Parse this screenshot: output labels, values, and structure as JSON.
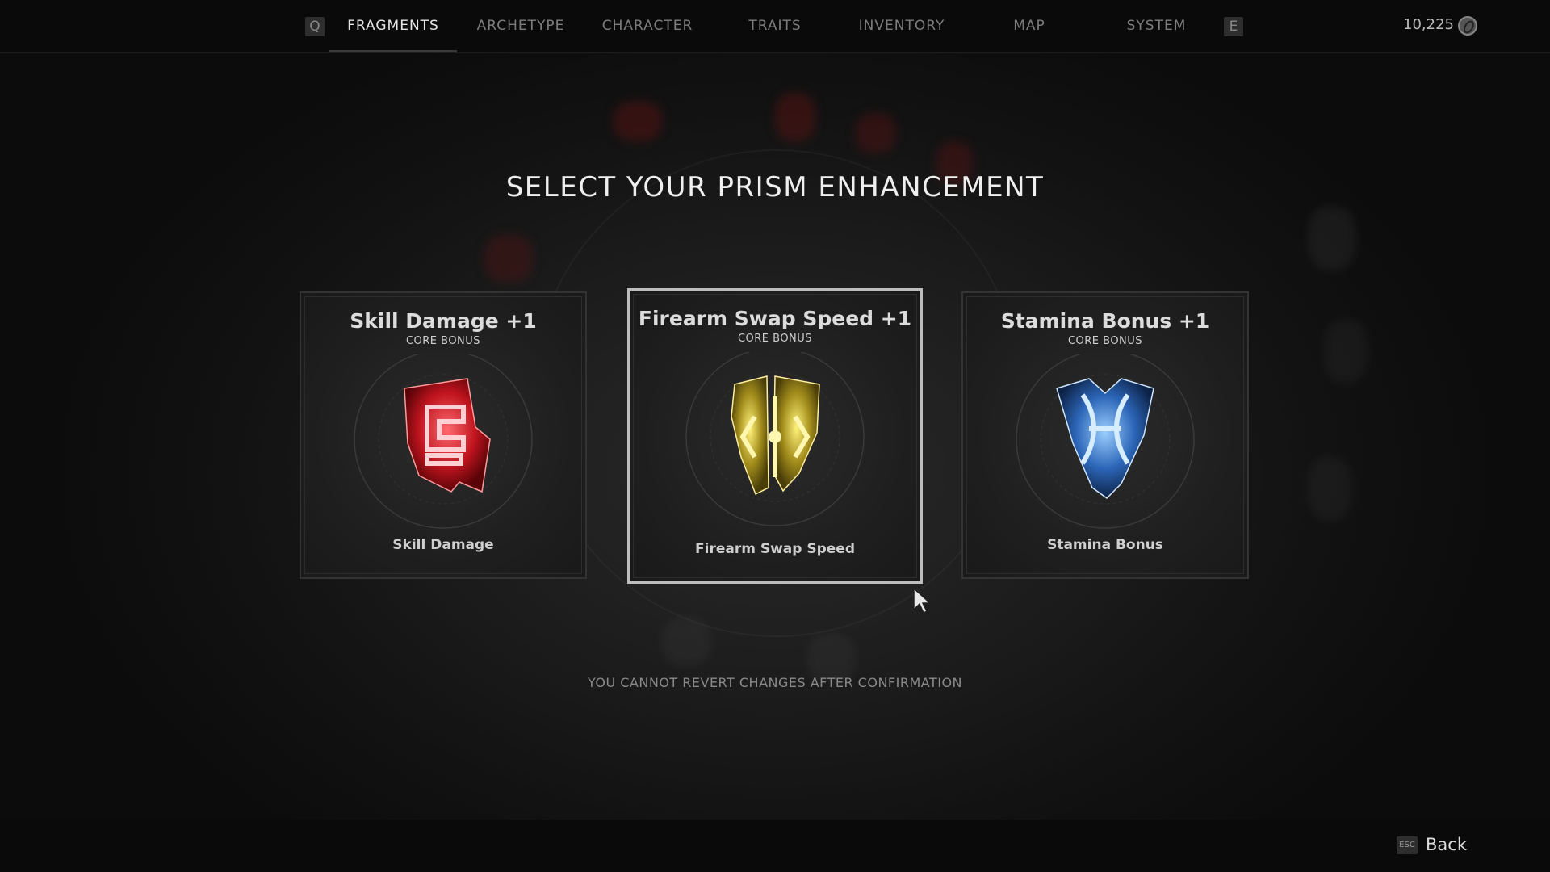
{
  "nav": {
    "left_key": "Q",
    "right_key": "E",
    "tabs": [
      {
        "label": "FRAGMENTS",
        "active": true
      },
      {
        "label": "ARCHETYPE",
        "active": false
      },
      {
        "label": "CHARACTER",
        "active": false
      },
      {
        "label": "TRAITS",
        "active": false
      },
      {
        "label": "INVENTORY",
        "active": false
      },
      {
        "label": "MAP",
        "active": false
      },
      {
        "label": "SYSTEM",
        "active": false
      }
    ],
    "currency": "10,225",
    "currency_icon": "scrap-coin-icon"
  },
  "title": "SELECT YOUR PRISM ENHANCEMENT",
  "cards": [
    {
      "title": "Skill Damage +1",
      "subtitle": "CORE BONUS",
      "name": "Skill Damage",
      "icon": "red-fragment-icon",
      "color": "#e0222c",
      "selected": false
    },
    {
      "title": "Firearm Swap Speed +1",
      "subtitle": "CORE BONUS",
      "name": "Firearm Swap Speed",
      "icon": "gold-fragment-icon",
      "color": "#c9b12a",
      "selected": true
    },
    {
      "title": "Stamina Bonus +1",
      "subtitle": "CORE BONUS",
      "name": "Stamina Bonus",
      "icon": "blue-fragment-icon",
      "color": "#3b7fd9",
      "selected": false
    }
  ],
  "warning": "YOU CANNOT REVERT CHANGES AFTER CONFIRMATION",
  "footer": {
    "esc_key": "ESC",
    "back_label": "Back"
  }
}
